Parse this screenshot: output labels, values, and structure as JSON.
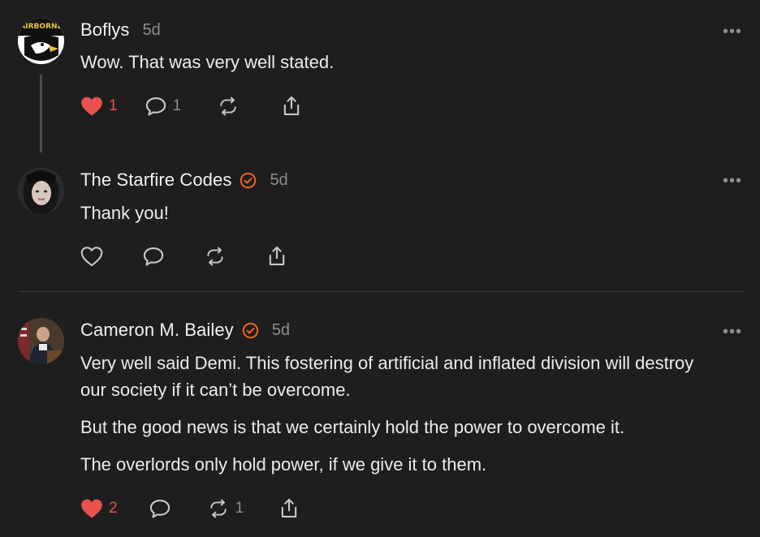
{
  "comments": [
    {
      "author": "Boflys",
      "verified": false,
      "time": "5d",
      "more": "•••",
      "paragraphs": [
        "Wow. That was very well stated."
      ],
      "actions": {
        "like_count": "1",
        "liked": true,
        "reply_count": "1",
        "restack_count": ""
      },
      "avatar_text": "AIRBORNE"
    },
    {
      "author": "The Starfire Codes",
      "verified": true,
      "time": "5d",
      "more": "•••",
      "paragraphs": [
        "Thank you!"
      ],
      "actions": {
        "like_count": "",
        "liked": false,
        "reply_count": "",
        "restack_count": ""
      }
    },
    {
      "author": "Cameron M. Bailey",
      "verified": true,
      "time": "5d",
      "more": "•••",
      "paragraphs": [
        "Very well said Demi. This fostering of artificial and inflated division will destroy our society if it can’t be overcome.",
        "But the good news is that we certainly hold the power to overcome it.",
        "The overlords only hold power, if we give it to them."
      ],
      "actions": {
        "like_count": "2",
        "liked": true,
        "reply_count": "",
        "restack_count": "1"
      }
    }
  ],
  "colors": {
    "accent": "#ff6719",
    "like": "#e8514f",
    "muted": "#8e8e92",
    "background": "#1e1e1f"
  },
  "icons": [
    "heart-icon",
    "comment-icon",
    "restack-icon",
    "share-icon",
    "verified-icon",
    "more-icon"
  ]
}
